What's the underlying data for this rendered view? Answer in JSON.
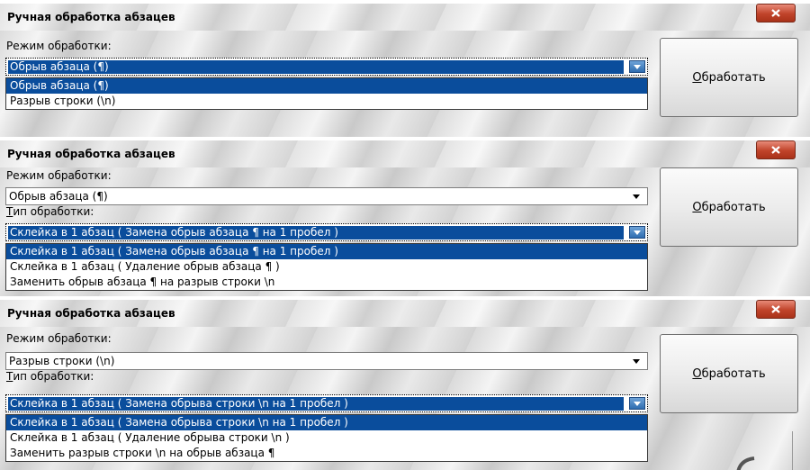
{
  "windows": [
    {
      "title": "Ручная обработка абзацев",
      "mode_label": "Режим обработки:",
      "mode_value": "Обрыв абзаца (¶)",
      "mode_options": [
        "Обрыв абзаца (¶)",
        "Разрыв строки (\\n)"
      ],
      "process_button": {
        "accel": "О",
        "rest": "бработать"
      }
    },
    {
      "title": "Ручная обработка абзацев",
      "mode_label": "Режим обработки:",
      "mode_value": "Обрыв абзаца (¶)",
      "type_label": {
        "accel": "Т",
        "rest": "ип обработки:"
      },
      "type_value": "Склейка в 1 абзац ( Замена обрыв абзаца ¶ на 1 пробел )",
      "type_options": [
        "Склейка в 1 абзац ( Замена обрыв абзаца ¶ на 1 пробел )",
        "Склейка в 1 абзац ( Удаление обрыв абзаца ¶ )",
        "Заменить обрыв абзаца ¶ на разрыв строки \\n"
      ],
      "process_button": {
        "accel": "О",
        "rest": "бработать"
      }
    },
    {
      "title": "Ручная обработка абзацев",
      "mode_label": "Режим обработки:",
      "mode_value": "Разрыв строки (\\n)",
      "type_label": {
        "accel": "Т",
        "rest": "ип обработки:"
      },
      "type_value": "Склейка в 1 абзац ( Замена обрыва строки \\n на 1 пробел )",
      "type_options": [
        "Склейка в 1 абзац ( Замена обрыва строки \\n на 1 пробел )",
        "Склейка в 1 абзац ( Удаление обрыва строки \\n )",
        "Заменить разрыв строки \\n на обрыв абзаца ¶"
      ],
      "process_button": {
        "accel": "О",
        "rest": "бработать"
      }
    }
  ],
  "icons": {
    "close": "close-icon",
    "dropdown": "chevron-down-icon"
  },
  "colors": {
    "selection": "#0a4d9c",
    "close_button": "#c0432a"
  }
}
